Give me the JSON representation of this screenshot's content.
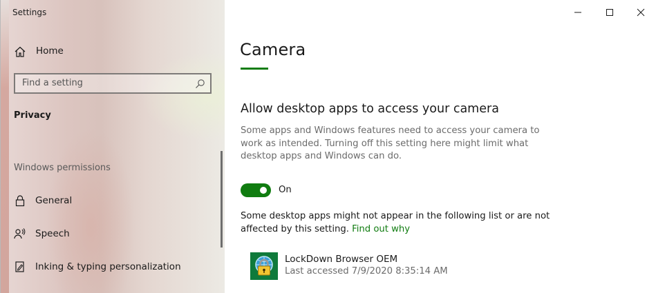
{
  "window": {
    "title": "Settings",
    "controls": {
      "minimize": "minimize",
      "maximize": "maximize",
      "close": "close"
    }
  },
  "sidebar": {
    "home_label": "Home",
    "search_placeholder": "Find a setting",
    "section_label": "Privacy",
    "group_header": "Windows permissions",
    "items": [
      {
        "label": "General",
        "icon": "lock-icon"
      },
      {
        "label": "Speech",
        "icon": "speech-icon"
      },
      {
        "label": "Inking & typing personalization",
        "icon": "inking-icon"
      }
    ]
  },
  "main": {
    "title": "Camera",
    "subheading": "Allow desktop apps to access your camera",
    "description": "Some apps and Windows features need to access your camera to work as intended. Turning off this setting here might limit what desktop apps and Windows can do.",
    "toggle": {
      "state": "On",
      "on": true
    },
    "note_text": "Some desktop apps might not appear in the following list or are not affected by this setting. ",
    "note_link": "Find out why",
    "apps": [
      {
        "name": "LockDown Browser OEM",
        "last_accessed": "Last accessed 7/9/2020 8:35:14 AM",
        "icon": "lockdown-browser-icon"
      }
    ]
  },
  "colors": {
    "accent": "#107c10",
    "app_icon_bg": "#0f7a3b"
  }
}
